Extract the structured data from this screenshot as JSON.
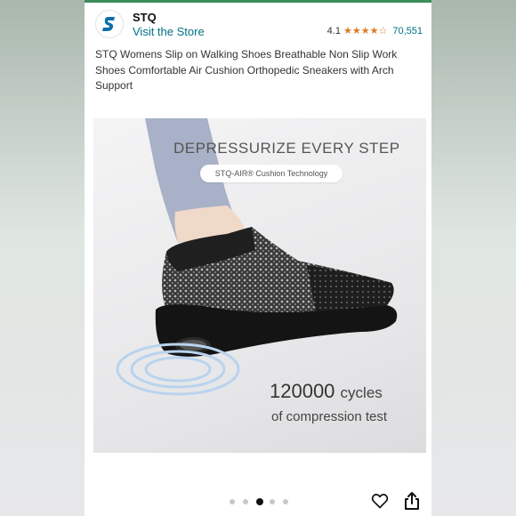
{
  "brand": {
    "name": "STQ",
    "visit_store": "Visit the Store",
    "rating": "4.1",
    "rating_count": "70,551",
    "stars": [
      "full",
      "full",
      "full",
      "full",
      "empty"
    ]
  },
  "product": {
    "title": "STQ Womens Slip on Walking Shoes Breathable Non Slip Work Shoes Comfortable Air Cushion Orthopedic Sneakers with Arch Support"
  },
  "image": {
    "headline": "DEPRESSURIZE EVERY STEP",
    "tagline": "STQ-AIR® Cushion Technology",
    "cycles_number": "120000",
    "cycles_word": "cycles",
    "subtext": "of compression test"
  },
  "carousel": {
    "total": 5,
    "active_index": 2
  },
  "colors": {
    "accent": "#3b8e5a",
    "link": "#007185",
    "star": "#de7921"
  },
  "icons": {
    "brand": "stq-logo",
    "favorite": "heart-icon",
    "share": "share-icon"
  }
}
